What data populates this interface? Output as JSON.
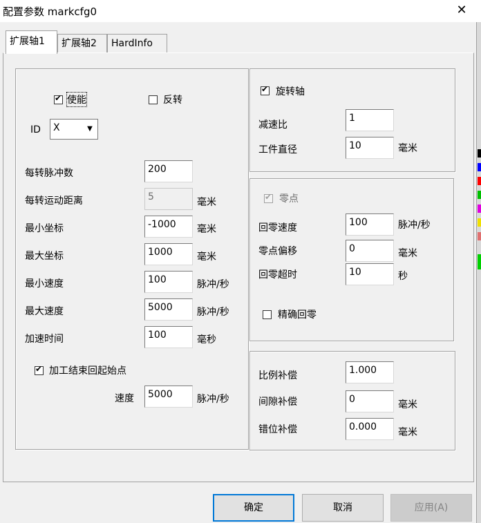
{
  "window": {
    "title": "配置参数 markcfg0",
    "close_glyph": "✕"
  },
  "tabs": [
    {
      "label": "扩展轴1",
      "active": true
    },
    {
      "label": "扩展轴2",
      "active": false
    },
    {
      "label": "HardInfo",
      "active": false
    }
  ],
  "left": {
    "enable_label": "使能",
    "enable_checked": true,
    "reverse_label": "反转",
    "reverse_checked": false,
    "id_label": "ID",
    "id_value": "X",
    "rows": [
      {
        "label": "每转脉冲数",
        "value": "200",
        "unit": ""
      },
      {
        "label": "每转运动距离",
        "value": "5",
        "unit": "毫米"
      },
      {
        "label": "最小坐标",
        "value": "-1000",
        "unit": "毫米"
      },
      {
        "label": "最大坐标",
        "value": "1000",
        "unit": "毫米"
      },
      {
        "label": "最小速度",
        "value": "100",
        "unit": "脉冲/秒"
      },
      {
        "label": "最大速度",
        "value": "5000",
        "unit": "脉冲/秒"
      },
      {
        "label": "加速时间",
        "value": "100",
        "unit": "毫秒"
      }
    ],
    "return_start_label": "加工结束回起始点",
    "return_start_checked": true,
    "speed_label": "速度",
    "speed_value": "5000",
    "speed_unit": "脉冲/秒"
  },
  "rotary": {
    "label": "旋转轴",
    "checked": true,
    "ratio_label": "减速比",
    "ratio_value": "1",
    "diameter_label": "工件直径",
    "diameter_value": "10",
    "diameter_unit": "毫米"
  },
  "home": {
    "label": "零点",
    "checked": true,
    "speed_label": "回零速度",
    "speed_value": "100",
    "speed_unit": "脉冲/秒",
    "offset_label": "零点偏移",
    "offset_value": "0",
    "offset_unit": "毫米",
    "timeout_label": "回零超时",
    "timeout_value": "10",
    "timeout_unit": "秒",
    "precise_label": "精确回零",
    "precise_checked": false
  },
  "comp": {
    "scale_label": "比例补偿",
    "scale_value": "1.000",
    "gap_label": "间隙补偿",
    "gap_value": "0",
    "gap_unit": "毫米",
    "offset_label": "错位补偿",
    "offset_value": "0.000",
    "offset_unit": "毫米"
  },
  "buttons": {
    "ok": "确定",
    "cancel": "取消",
    "apply": "应用(A)"
  }
}
